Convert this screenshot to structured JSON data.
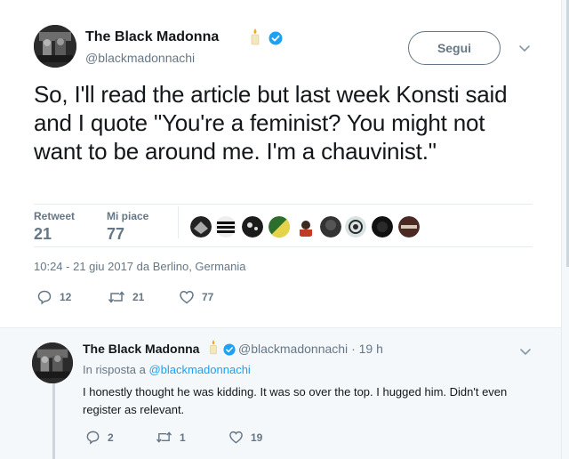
{
  "tweet": {
    "author_name": "The Black Madonna",
    "author_handle": "@blackmadonnachi",
    "follow_label": "Segui",
    "text": "So, I'll read the article but last week Konsti said and I quote \"You're a feminist? You might not want to be around me. I'm a chauvinist.\"",
    "stats": {
      "retweet_label": "Retweet",
      "retweet_count": "21",
      "likes_label": "Mi piace",
      "likes_count": "77"
    },
    "timestamp": "10:24 - 21 giu 2017 da ",
    "location": "Berlino, Germania",
    "actions": {
      "replies": "12",
      "retweets": "21",
      "likes": "77"
    }
  },
  "reply": {
    "author_name": "The Black Madonna",
    "author_handle": "@blackmadonnachi",
    "time": "19 h",
    "time_separator": "·",
    "in_reply_prefix": "In risposta a",
    "in_reply_handle": "@blackmadonnachi",
    "text": "I honestly thought he was kidding. It was so over the top. I hugged him. Didn't even register as relevant.",
    "actions": {
      "replies": "2",
      "retweets": "1",
      "likes": "19"
    }
  },
  "icons": {
    "avatar": "avatar-image",
    "candle": "candle-emoji",
    "verified": "verified-badge-icon",
    "chevron": "chevron-down-icon",
    "reply": "reply-icon",
    "retweet": "retweet-icon",
    "like": "heart-icon"
  },
  "colors": {
    "text": "#14171a",
    "secondary": "#657786",
    "link": "#1da1f2",
    "verified": "#1da1f2",
    "reply_background": "#f5f8fa",
    "border": "#e6ecf0"
  }
}
